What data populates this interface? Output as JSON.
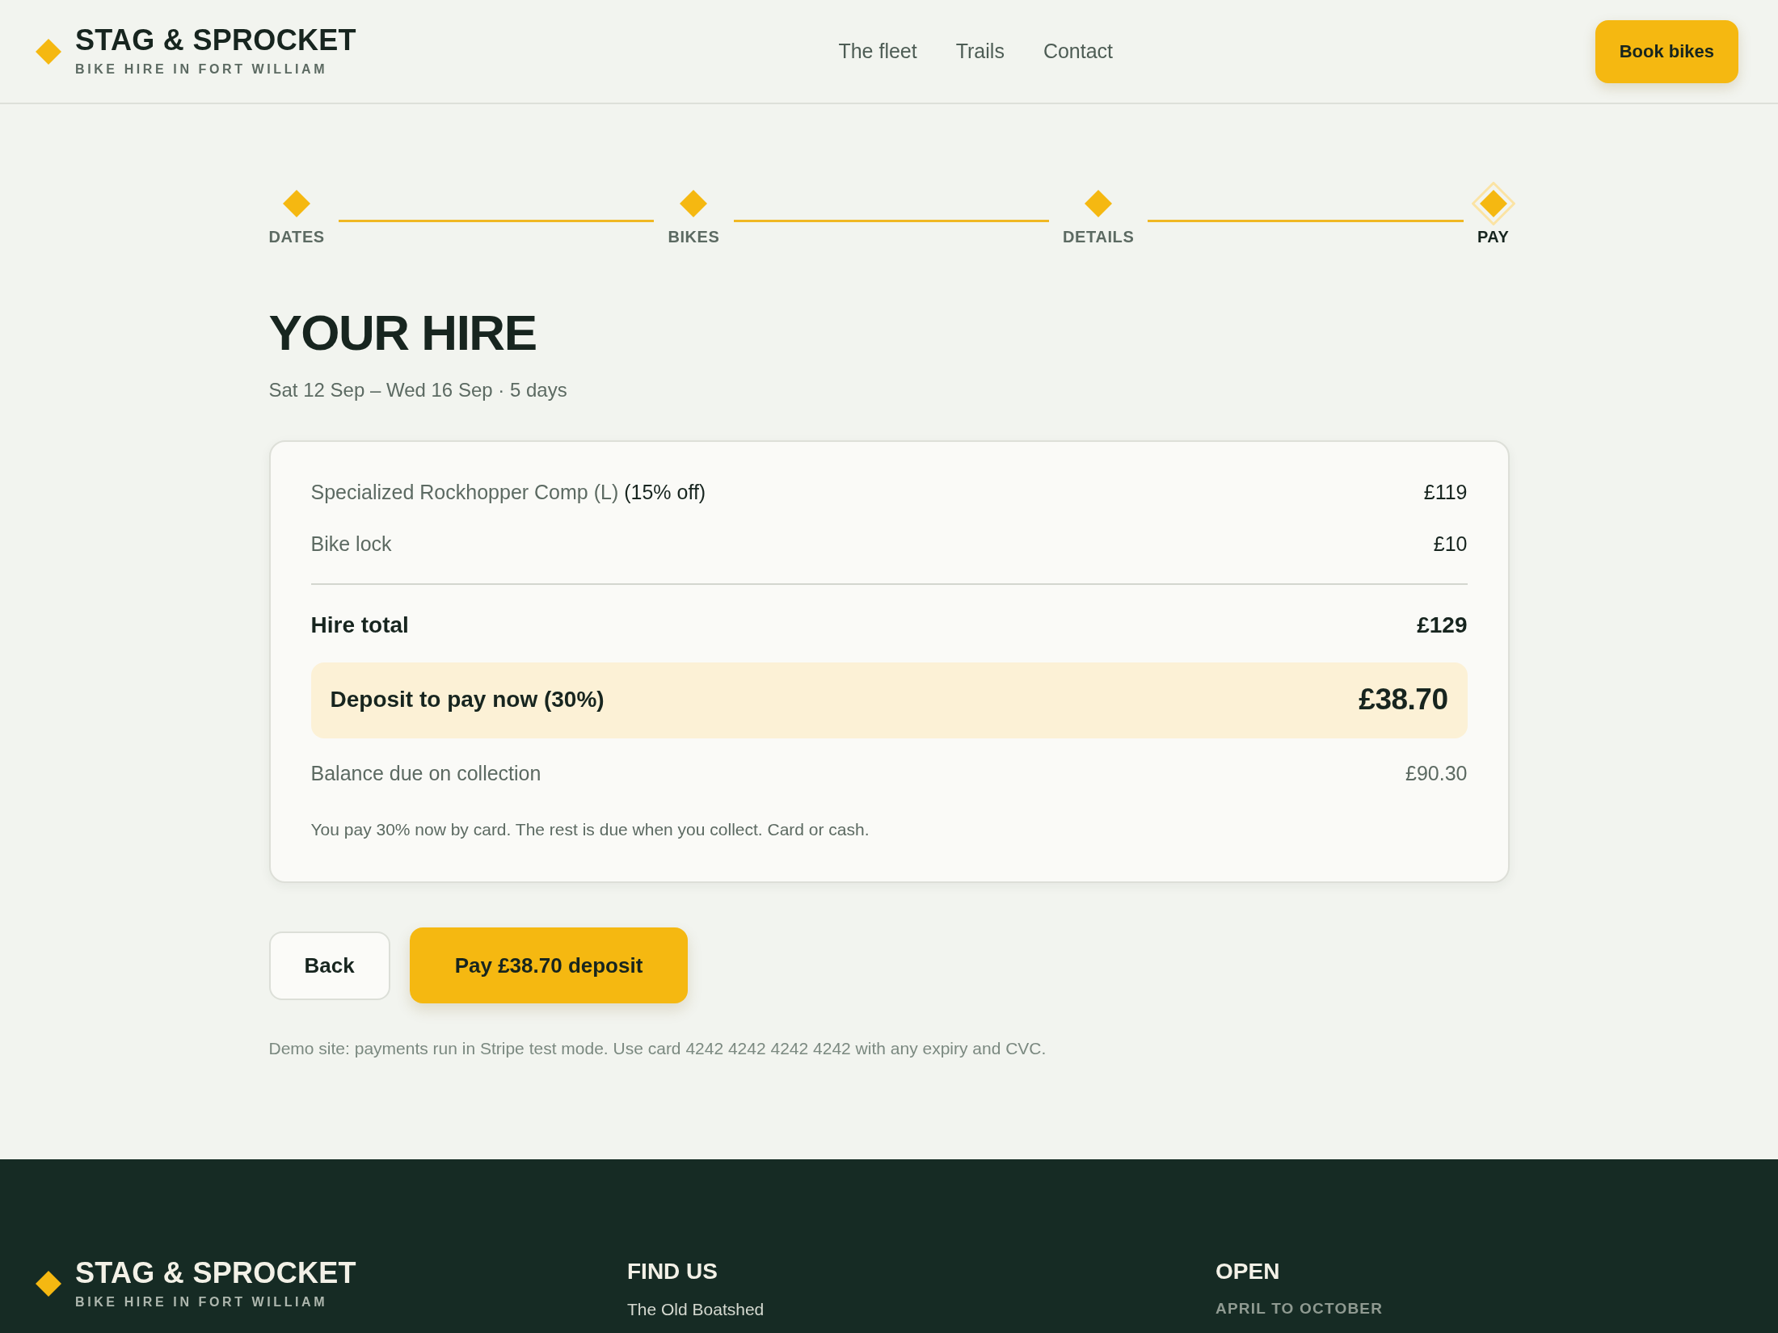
{
  "header": {
    "brand": {
      "name": "STAG & SPROCKET",
      "tagline": "BIKE HIRE IN FORT WILLIAM"
    },
    "nav": [
      "The fleet",
      "Trails",
      "Contact"
    ],
    "cta": "Book bikes"
  },
  "stepper": [
    {
      "label": "DATES",
      "current": false
    },
    {
      "label": "BIKES",
      "current": false
    },
    {
      "label": "DETAILS",
      "current": false
    },
    {
      "label": "PAY",
      "current": true
    }
  ],
  "hire": {
    "title": "YOUR HIRE",
    "dates": "Sat 12 Sep – Wed 16 Sep · 5 days"
  },
  "summary": {
    "items": [
      {
        "name": "Specialized Rockhopper Comp (L)",
        "note": "(15% off)",
        "price": "£119"
      },
      {
        "name": "Bike lock",
        "price": "£10"
      }
    ],
    "total": {
      "label": "Hire total",
      "amount": "£129"
    },
    "deposit": {
      "label": "Deposit to pay now (30%)",
      "amount": "£38.70"
    },
    "balance": {
      "label": "Balance due on collection",
      "amount": "£90.30"
    },
    "note": "You pay 30% now by card. The rest is due when you collect. Card or cash."
  },
  "actions": [
    {
      "label": "Back",
      "kind": "secondary"
    },
    {
      "label": "Pay £38.70 deposit",
      "kind": "primary"
    }
  ],
  "demo_note": "Demo site: payments run in Stripe test mode. Use card 4242 4242 4242 4242 with any expiry and CVC.",
  "footer": {
    "brand": {
      "name": "STAG & SPROCKET",
      "tagline": "BIKE HIRE IN FORT WILLIAM"
    },
    "columns": [
      {
        "heading": "FIND US",
        "lines": [
          {
            "kind": "text",
            "text": "The Old Boatshed"
          }
        ]
      },
      {
        "heading": "OPEN",
        "lines": [
          {
            "kind": "caption",
            "text": "APRIL TO OCTOBER"
          }
        ]
      }
    ]
  }
}
